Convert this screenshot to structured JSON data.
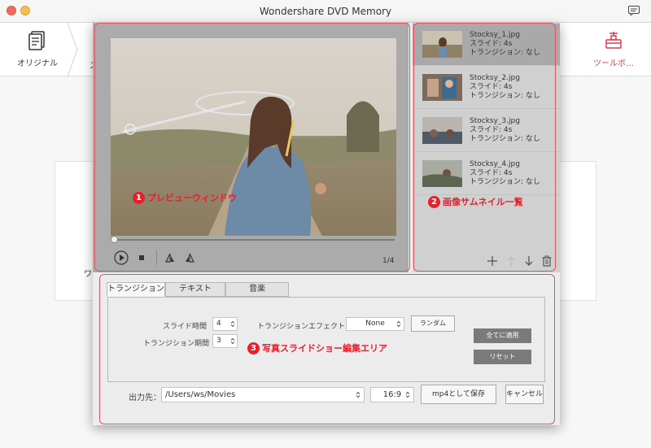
{
  "window": {
    "title": "Wondershare DVD Memory"
  },
  "toolbar": {
    "original_label": "オリジナル",
    "partial_label": "ス",
    "toolbox_label": "ツールボ…"
  },
  "content": {
    "partial_label": "ワン"
  },
  "preview": {
    "page_indicator": "1/4"
  },
  "thumbnails": [
    {
      "name": "Stocksy_1.jpg",
      "slide": "スライド: 4s",
      "transition": "トランジション: なし",
      "selected": true
    },
    {
      "name": "Stocksy_2.jpg",
      "slide": "スライド: 4s",
      "transition": "トランジション: なし",
      "selected": false
    },
    {
      "name": "Stocksy_3.jpg",
      "slide": "スライド: 4s",
      "transition": "トランジション: なし",
      "selected": false
    },
    {
      "name": "Stocksy_4.jpg",
      "slide": "スライド: 4s",
      "transition": "トランジション: なし",
      "selected": false
    }
  ],
  "tabs": [
    {
      "label": "トランジション",
      "active": true
    },
    {
      "label": "テキスト",
      "active": false
    },
    {
      "label": "音楽",
      "active": false
    }
  ],
  "settings": {
    "slide_time_label": "スライド時間",
    "slide_time_value": "4",
    "transition_period_label": "トランジション期間",
    "transition_period_value": "3",
    "transition_effect_label": "トランジションエフェクト",
    "transition_effect_value": "None",
    "random_label": "ランダム",
    "apply_all_label": "全てに適用",
    "reset_label": "リセット"
  },
  "output": {
    "label": "出力先：",
    "path": "/Users/ws/Movies",
    "aspect": "16:9",
    "save_label": "mp4として保存",
    "cancel_label": "キャンセル"
  },
  "annotations": {
    "preview": {
      "num": "1",
      "text": "プレビューウィンドウ"
    },
    "thumbs": {
      "num": "2",
      "text": "画像サムネイル一覧"
    },
    "editor": {
      "num": "3",
      "text": "写真スライドショー編集エリア"
    }
  },
  "colors": {
    "accent": "#e0384f",
    "annotation": "#e8202a",
    "annotation_border": "#e8505b"
  }
}
